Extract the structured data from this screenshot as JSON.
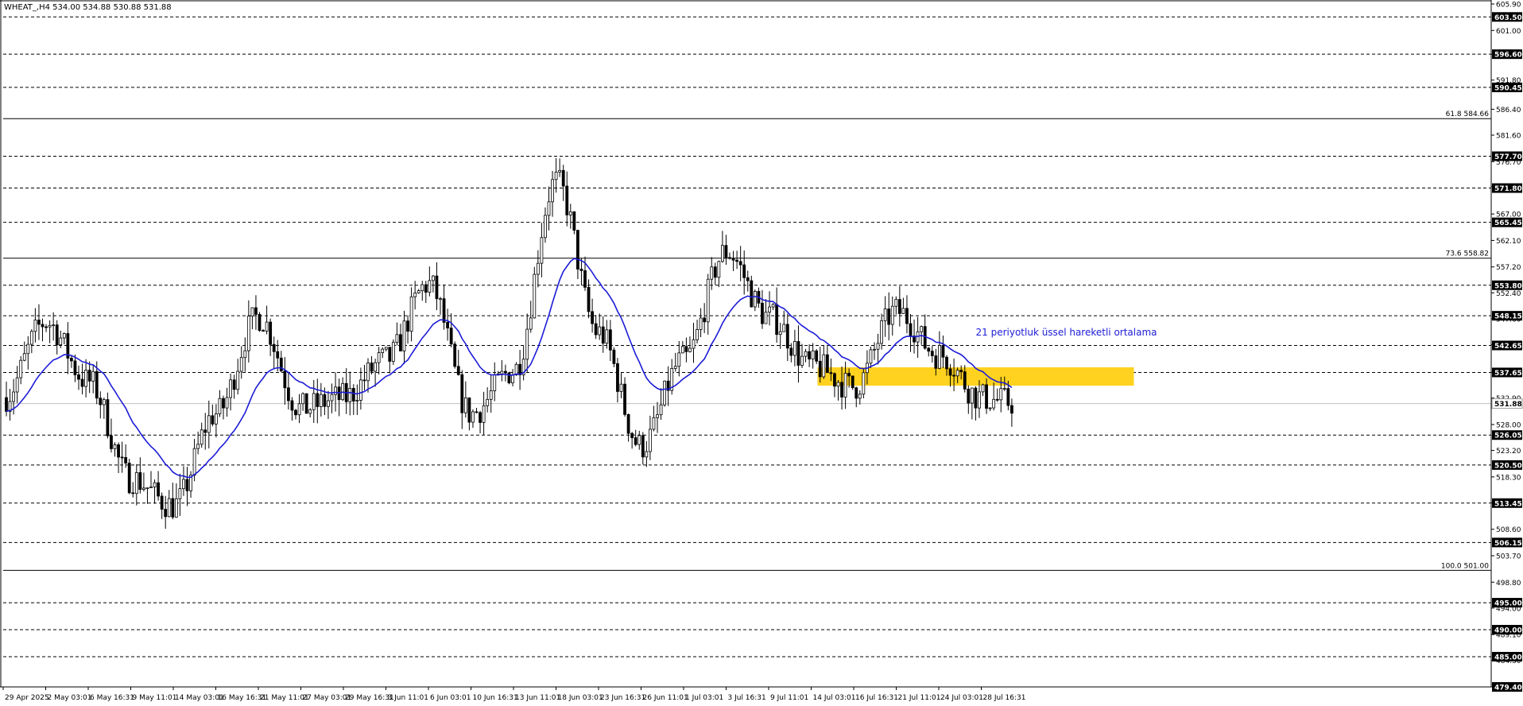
{
  "chart_data": {
    "type": "candlestick",
    "symbol_header": {
      "symbol": "WHEAT_,H4",
      "open": "534.00",
      "high": "534.88",
      "low": "530.88",
      "close": "531.88"
    },
    "ylim": [
      479.4,
      605.9
    ],
    "y_ticks": [
      "605.90",
      "601.00",
      "596.60",
      "591.80",
      "586.40",
      "581.60",
      "576.70",
      "572.10",
      "567.00",
      "562.10",
      "557.20",
      "552.40",
      "547.60",
      "542.80",
      "537.70",
      "532.90",
      "528.00",
      "523.20",
      "518.30",
      "513.50",
      "508.60",
      "503.70",
      "498.80",
      "494.00",
      "489.10",
      "484.30",
      "479.40"
    ],
    "x_labels": [
      "29 Apr 2025",
      "2 May 03:01",
      "6 May 16:31",
      "9 May 11:01",
      "14 May 03:01",
      "16 May 16:31",
      "21 May 11:01",
      "27 May 03:01",
      "29 May 16:31",
      "3 Jun 11:01",
      "6 Jun 03:01",
      "10 Jun 16:31",
      "13 Jun 11:01",
      "18 Jun 03:01",
      "23 Jun 16:31",
      "26 Jun 11:01",
      "1 Jul 03:01",
      "3 Jul 16:31",
      "9 Jul 11:01",
      "14 Jul 03:01",
      "16 Jul 16:31",
      "21 Jul 11:01",
      "24 Jul 03:01",
      "28 Jul 16:31"
    ],
    "levels": [
      {
        "value": 603.5,
        "label": "603.50"
      },
      {
        "value": 596.6,
        "label": "596.60"
      },
      {
        "value": 590.45,
        "label": "590.45"
      },
      {
        "value": 577.7,
        "label": "577.70"
      },
      {
        "value": 571.8,
        "label": "571.80"
      },
      {
        "value": 565.45,
        "label": "565.45"
      },
      {
        "value": 553.8,
        "label": "553.80"
      },
      {
        "value": 548.15,
        "label": "548.15"
      },
      {
        "value": 542.65,
        "label": "542.65"
      },
      {
        "value": 537.65,
        "label": "537.65"
      },
      {
        "value": 526.05,
        "label": "526.05"
      },
      {
        "value": 520.5,
        "label": "520.50"
      },
      {
        "value": 513.45,
        "label": "513.45"
      },
      {
        "value": 506.15,
        "label": "506.15"
      },
      {
        "value": 495.0,
        "label": "495.00"
      },
      {
        "value": 490.0,
        "label": "490.00"
      },
      {
        "value": 485.0,
        "label": "485.00"
      },
      {
        "value": 479.4,
        "label": "479.40"
      }
    ],
    "fib_levels": [
      {
        "value": 584.66,
        "label": "61.8 584.66"
      },
      {
        "value": 558.82,
        "label": "73.6 558.82"
      },
      {
        "value": 501.0,
        "label": "100.0 501.00"
      }
    ],
    "current_price": {
      "value": 531.88,
      "label": "531.88"
    },
    "zone": {
      "from_label": "14 Jul 03:01",
      "to_label": "28 Jul 16:31",
      "low": 535.2,
      "high": 538.6,
      "color": "#ffd21f"
    },
    "ema": {
      "color": "#1c1cd8"
    },
    "annotation": {
      "text": "21 periyotluk üssel hareketli ortalama",
      "color": "#1c1cd8"
    },
    "waypoints": [
      {
        "x": "29 Apr 2025",
        "y": 533
      },
      {
        "x": "2 May 03:01",
        "y": 547
      },
      {
        "x": "6 May 16:31",
        "y": 536
      },
      {
        "x": "9 May 11:01",
        "y": 518
      },
      {
        "x": "14 May 03:01",
        "y": 513
      },
      {
        "x": "16 May 16:31",
        "y": 530
      },
      {
        "x": "21 May 11:01",
        "y": 548
      },
      {
        "x": "27 May 03:01",
        "y": 531
      },
      {
        "x": "29 May 16:31",
        "y": 533
      },
      {
        "x": "3 Jun 11:01",
        "y": 540
      },
      {
        "x": "6 Jun 03:01",
        "y": 554
      },
      {
        "x": "10 Jun 16:31",
        "y": 530
      },
      {
        "x": "13 Jun 11:01",
        "y": 538
      },
      {
        "x": "18 Jun 03:01",
        "y": 573
      },
      {
        "x": "23 Jun 16:31",
        "y": 545
      },
      {
        "x": "26 Jun 11:01",
        "y": 524
      },
      {
        "x": "1 Jul 03:01",
        "y": 540
      },
      {
        "x": "3 Jul 16:31",
        "y": 560
      },
      {
        "x": "9 Jul 11:01",
        "y": 548
      },
      {
        "x": "14 Jul 03:01",
        "y": 539
      },
      {
        "x": "16 Jul 16:31",
        "y": 535
      },
      {
        "x": "21 Jul 11:01",
        "y": 549
      },
      {
        "x": "24 Jul 03:01",
        "y": 541
      },
      {
        "x": "28 Jul 16:31",
        "y": 533
      }
    ],
    "colors": {
      "candle": "#000000",
      "grid": "#000000",
      "axis_text": "#000000"
    }
  }
}
